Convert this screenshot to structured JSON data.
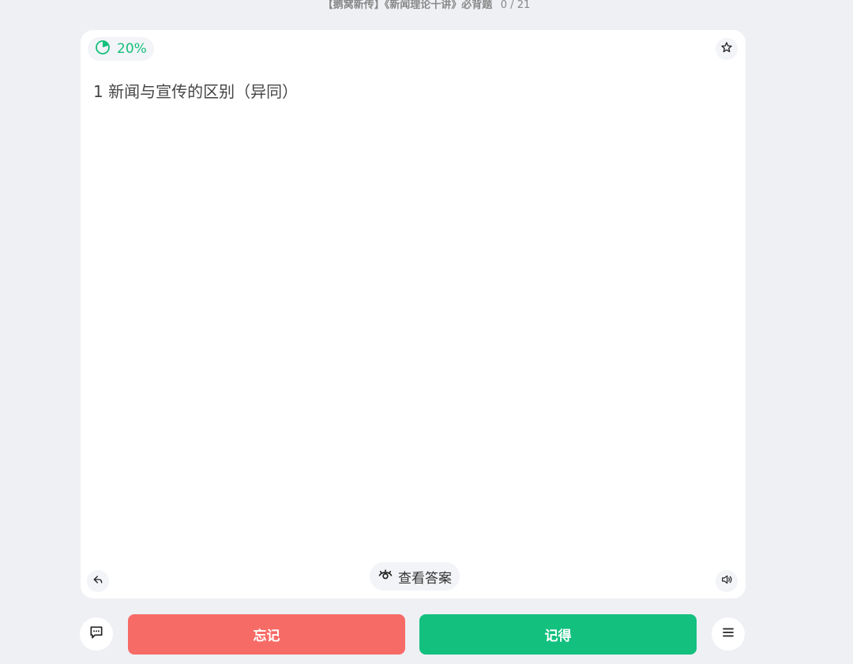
{
  "header": {
    "title": "【鹅窝新传】《新闻理论十讲》必背题",
    "counter": "0 / 21"
  },
  "card": {
    "progress_percent": "20%",
    "progress_fraction": 0.2,
    "question": "1 新闻与宣传的区别（异同）",
    "reveal_label": "查看答案"
  },
  "actions": {
    "forget_label": "忘记",
    "remember_label": "记得"
  },
  "colors": {
    "accent_green": "#13c07e",
    "forget_red": "#f76b66",
    "background": "#eef0f4"
  },
  "icons": [
    "pie-progress-icon",
    "star-icon",
    "undo-icon",
    "speaker-icon",
    "eye-icon",
    "comment-icon",
    "menu-icon"
  ]
}
